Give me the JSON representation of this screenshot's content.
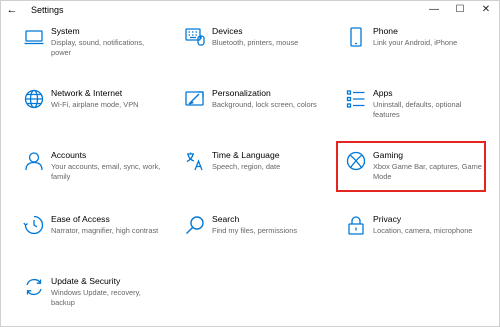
{
  "window": {
    "title": "Settings",
    "back_glyph": "←",
    "minimize_glyph": "—",
    "maximize_glyph": "☐",
    "close_glyph": "✕"
  },
  "accent_color": "#0078d7",
  "highlight_color": "#e3261f",
  "tiles": [
    {
      "name": "System",
      "desc": "Display, sound, notifications, power",
      "icon": "laptop-icon"
    },
    {
      "name": "Devices",
      "desc": "Bluetooth, printers, mouse",
      "icon": "keyboard-icon"
    },
    {
      "name": "Phone",
      "desc": "Link your Android, iPhone",
      "icon": "phone-icon"
    },
    {
      "name": "Network & Internet",
      "desc": "Wi-Fi, airplane mode, VPN",
      "icon": "globe-icon"
    },
    {
      "name": "Personalization",
      "desc": "Background, lock screen, colors",
      "icon": "paint-brush-icon"
    },
    {
      "name": "Apps",
      "desc": "Uninstall, defaults, optional features",
      "icon": "apps-list-icon"
    },
    {
      "name": "Accounts",
      "desc": "Your accounts, email, sync, work, family",
      "icon": "person-icon"
    },
    {
      "name": "Time & Language",
      "desc": "Speech, region, date",
      "icon": "time-language-icon"
    },
    {
      "name": "Gaming",
      "desc": "Xbox Game Bar, captures, Game Mode",
      "icon": "xbox-icon"
    },
    {
      "name": "Ease of Access",
      "desc": "Narrator, magnifier, high contrast",
      "icon": "ease-of-access-icon"
    },
    {
      "name": "Search",
      "desc": "Find my files, permissions",
      "icon": "search-icon"
    },
    {
      "name": "Privacy",
      "desc": "Location, camera, microphone",
      "icon": "lock-icon"
    },
    {
      "name": "Update & Security",
      "desc": "Windows Update, recovery, backup",
      "icon": "sync-icon"
    }
  ]
}
